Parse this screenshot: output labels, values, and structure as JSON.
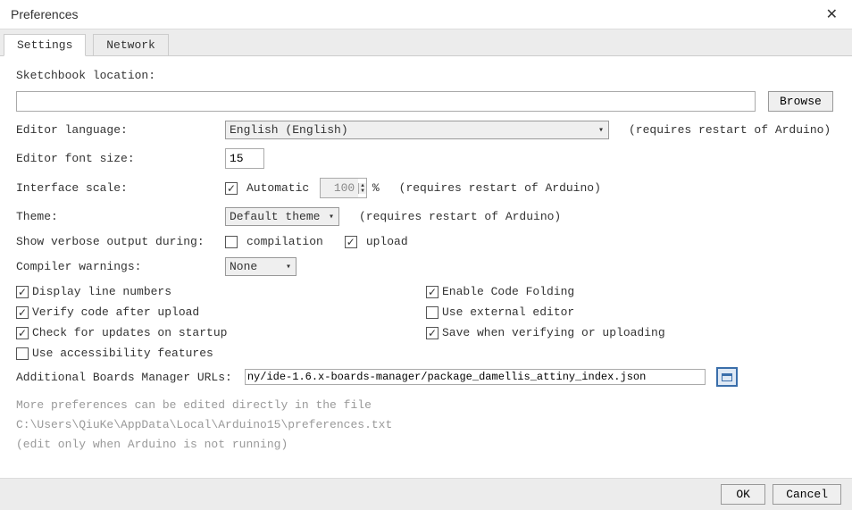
{
  "window": {
    "title": "Preferences"
  },
  "tabs": {
    "settings": "Settings",
    "network": "Network"
  },
  "labels": {
    "sketchbook": "Sketchbook location:",
    "browse": "Browse",
    "language": "Editor language:",
    "fontsize": "Editor font size:",
    "scale": "Interface scale:",
    "theme": "Theme:",
    "verbose": "Show verbose output during:",
    "compiler": "Compiler warnings:",
    "automatic": "Automatic",
    "compilation": "compilation",
    "upload": "upload",
    "restart": "(requires restart of Arduino)",
    "display_line": "Display line numbers",
    "enable_fold": "Enable Code Folding",
    "verify_upload": "Verify code after upload",
    "external_editor": "Use external editor",
    "check_updates": "Check for updates on startup",
    "save_verify": "Save when verifying or uploading",
    "accessibility": "Use accessibility features",
    "urls": "Additional Boards Manager URLs:",
    "more1": "More preferences can be edited directly in the file",
    "more2": "C:\\Users\\QiuKe\\AppData\\Local\\Arduino15\\preferences.txt",
    "more3": "(edit only when Arduino is not running)",
    "ok": "OK",
    "cancel": "Cancel",
    "percent": "%"
  },
  "values": {
    "sketchbook_path": "",
    "language": "English (English)",
    "fontsize": "15",
    "scale": "100",
    "theme": "Default theme",
    "warnings": "None",
    "urls": "ny/ide-1.6.x-boards-manager/package_damellis_attiny_index.json",
    "automatic": true,
    "compilation": false,
    "upload": true,
    "display_line": true,
    "verify_upload": true,
    "check_updates": true,
    "accessibility": false,
    "enable_fold": true,
    "external_editor": false,
    "save_verify": true
  }
}
